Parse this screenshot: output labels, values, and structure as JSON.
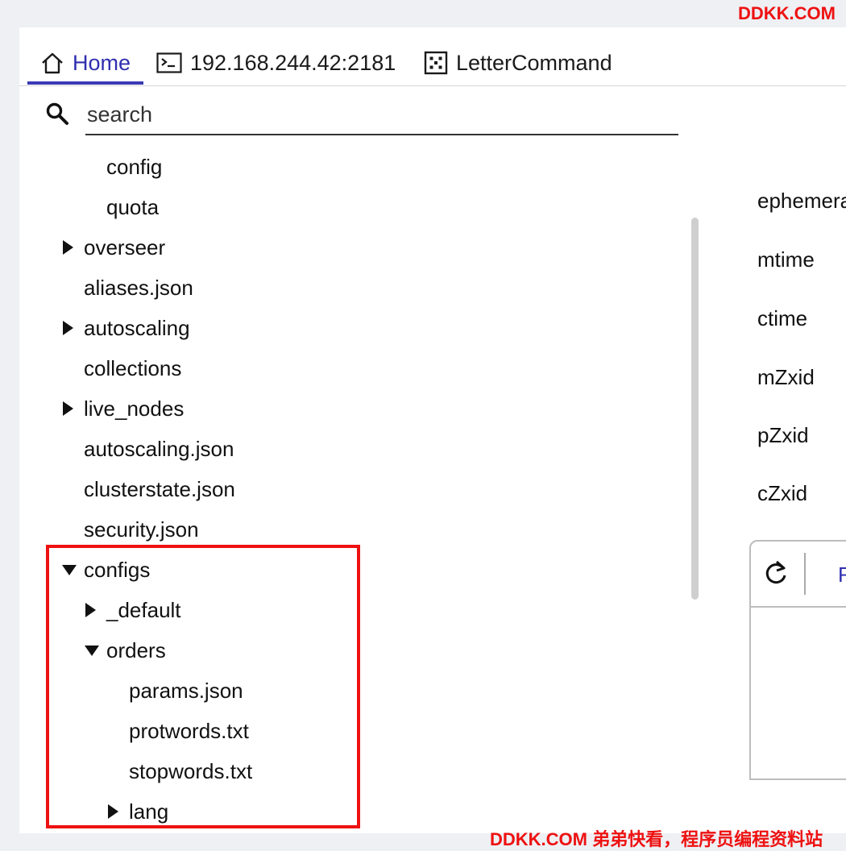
{
  "watermark": {
    "top": "DDKK.COM",
    "bottom": "DDKK.COM 弟弟快看，程序员编程资料站"
  },
  "tabs": [
    {
      "label": "Home",
      "icon": "home-icon",
      "active": true
    },
    {
      "label": "192.168.244.42:2181",
      "icon": "terminal-icon",
      "active": false
    },
    {
      "label": "LetterCommand",
      "icon": "dice-icon",
      "active": false
    }
  ],
  "search": {
    "placeholder": "search",
    "value": ""
  },
  "tree": {
    "items": [
      {
        "label": "config"
      },
      {
        "label": "quota"
      },
      {
        "label": "overseer"
      },
      {
        "label": "aliases.json"
      },
      {
        "label": "autoscaling"
      },
      {
        "label": "collections"
      },
      {
        "label": "live_nodes"
      },
      {
        "label": "autoscaling.json"
      },
      {
        "label": "clusterstate.json"
      },
      {
        "label": "security.json"
      },
      {
        "label": "configs"
      },
      {
        "label": "_default"
      },
      {
        "label": "orders"
      },
      {
        "label": "params.json"
      },
      {
        "label": "protwords.txt"
      },
      {
        "label": "stopwords.txt"
      },
      {
        "label": "lang"
      }
    ]
  },
  "node_props": {
    "labels": [
      "ephemera",
      "mtime",
      "ctime",
      "mZxid",
      "pZxid",
      "cZxid"
    ]
  },
  "panel": {
    "toolbar_label": "R"
  },
  "colors": {
    "accent": "#3a3ab5",
    "highlight": "#ee1111",
    "watermark": "#ee1111"
  }
}
